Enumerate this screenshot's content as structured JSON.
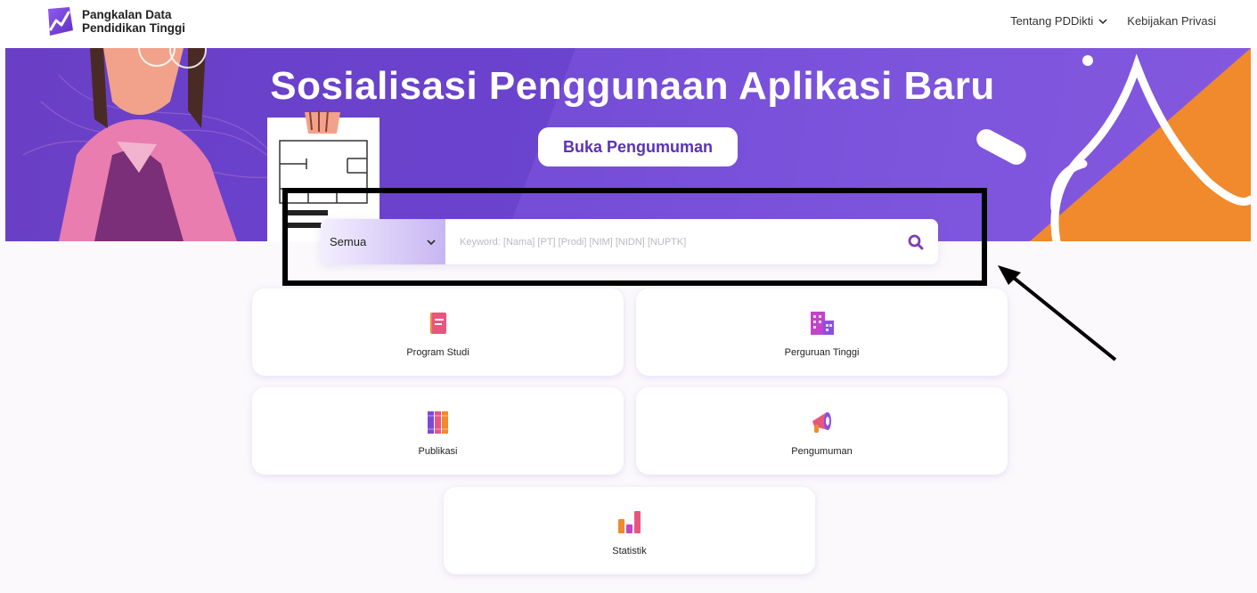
{
  "header": {
    "logo_line1": "Pangkalan Data",
    "logo_line2": "Pendidikan Tinggi",
    "nav": [
      {
        "label": "Tentang PDDikti",
        "has_dropdown": true
      },
      {
        "label": "Kebijakan Privasi",
        "has_dropdown": false
      }
    ]
  },
  "banner": {
    "title": "Sosialisasi Penggunaan Aplikasi Baru",
    "button": "Buka Pengumuman"
  },
  "search": {
    "category_value": "Semua",
    "placeholder": "Keyword: [Nama] [PT] [Prodi] [NIM] [NIDN] [NUPTK]",
    "icon": "search-icon"
  },
  "menu": [
    {
      "label": "Program Studi",
      "icon": "book-icon"
    },
    {
      "label": "Perguruan Tinggi",
      "icon": "building-icon"
    },
    {
      "label": "Publikasi",
      "icon": "books-icon"
    },
    {
      "label": "Pengumuman",
      "icon": "megaphone-icon"
    },
    {
      "label": "Statistik",
      "icon": "bar-chart-icon"
    }
  ],
  "colors": {
    "brand_purple": "#6a3fc6",
    "accent_orange": "#f08a2c",
    "search_icon": "#7a3fb3"
  }
}
